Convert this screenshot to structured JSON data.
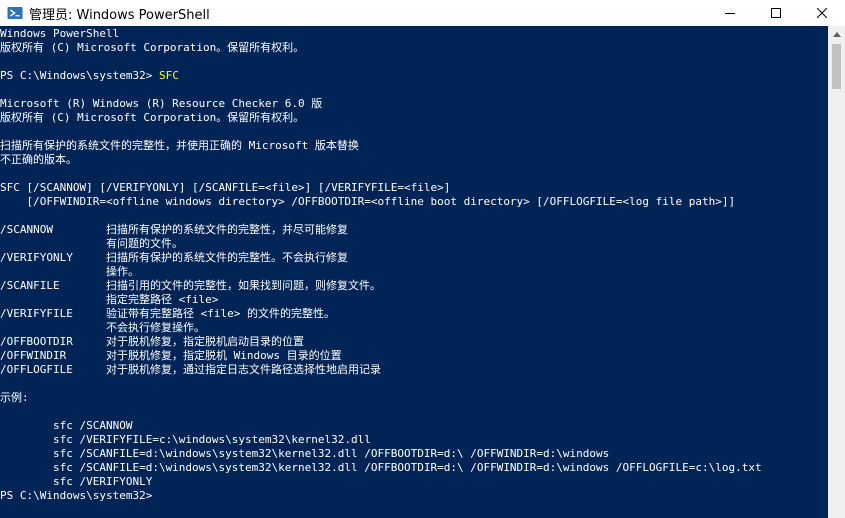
{
  "window": {
    "title": "管理员: Windows PowerShell"
  },
  "console": {
    "lines": [
      {
        "text": "Windows PowerShell"
      },
      {
        "text": "版权所有 (C) Microsoft Corporation。保留所有权利。"
      },
      {
        "text": ""
      },
      {
        "prompt": "PS C:\\Windows\\system32> ",
        "cmd": "SFC"
      },
      {
        "text": ""
      },
      {
        "text": "Microsoft (R) Windows (R) Resource Checker 6.0 版"
      },
      {
        "text": "版权所有 (C) Microsoft Corporation。保留所有权利。"
      },
      {
        "text": ""
      },
      {
        "text": "扫描所有保护的系统文件的完整性，并使用正确的 Microsoft 版本替换"
      },
      {
        "text": "不正确的版本。"
      },
      {
        "text": ""
      },
      {
        "text": "SFC [/SCANNOW] [/VERIFYONLY] [/SCANFILE=<file>] [/VERIFYFILE=<file>]"
      },
      {
        "text": "    [/OFFWINDIR=<offline windows directory> /OFFBOOTDIR=<offline boot directory> [/OFFLOGFILE=<log file path>]]"
      },
      {
        "text": ""
      },
      {
        "text": "/SCANNOW        扫描所有保护的系统文件的完整性，并尽可能修复"
      },
      {
        "text": "                有问题的文件。"
      },
      {
        "text": "/VERIFYONLY     扫描所有保护的系统文件的完整性。不会执行修复"
      },
      {
        "text": "                操作。"
      },
      {
        "text": "/SCANFILE       扫描引用的文件的完整性，如果找到问题，则修复文件。"
      },
      {
        "text": "                指定完整路径 <file>"
      },
      {
        "text": "/VERIFYFILE     验证带有完整路径 <file> 的文件的完整性。"
      },
      {
        "text": "                不会执行修复操作。"
      },
      {
        "text": "/OFFBOOTDIR     对于脱机修复，指定脱机启动目录的位置"
      },
      {
        "text": "/OFFWINDIR      对于脱机修复，指定脱机 Windows 目录的位置"
      },
      {
        "text": "/OFFLOGFILE     对于脱机修复，通过指定日志文件路径选择性地启用记录"
      },
      {
        "text": ""
      },
      {
        "text": "示例:"
      },
      {
        "text": ""
      },
      {
        "text": "        sfc /SCANNOW"
      },
      {
        "text": "        sfc /VERIFYFILE=c:\\windows\\system32\\kernel32.dll"
      },
      {
        "text": "        sfc /SCANFILE=d:\\windows\\system32\\kernel32.dll /OFFBOOTDIR=d:\\ /OFFWINDIR=d:\\windows"
      },
      {
        "text": "        sfc /SCANFILE=d:\\windows\\system32\\kernel32.dll /OFFBOOTDIR=d:\\ /OFFWINDIR=d:\\windows /OFFLOGFILE=c:\\log.txt"
      },
      {
        "text": "        sfc /VERIFYONLY"
      },
      {
        "prompt": "PS C:\\Windows\\system32>",
        "cmd": ""
      }
    ]
  }
}
